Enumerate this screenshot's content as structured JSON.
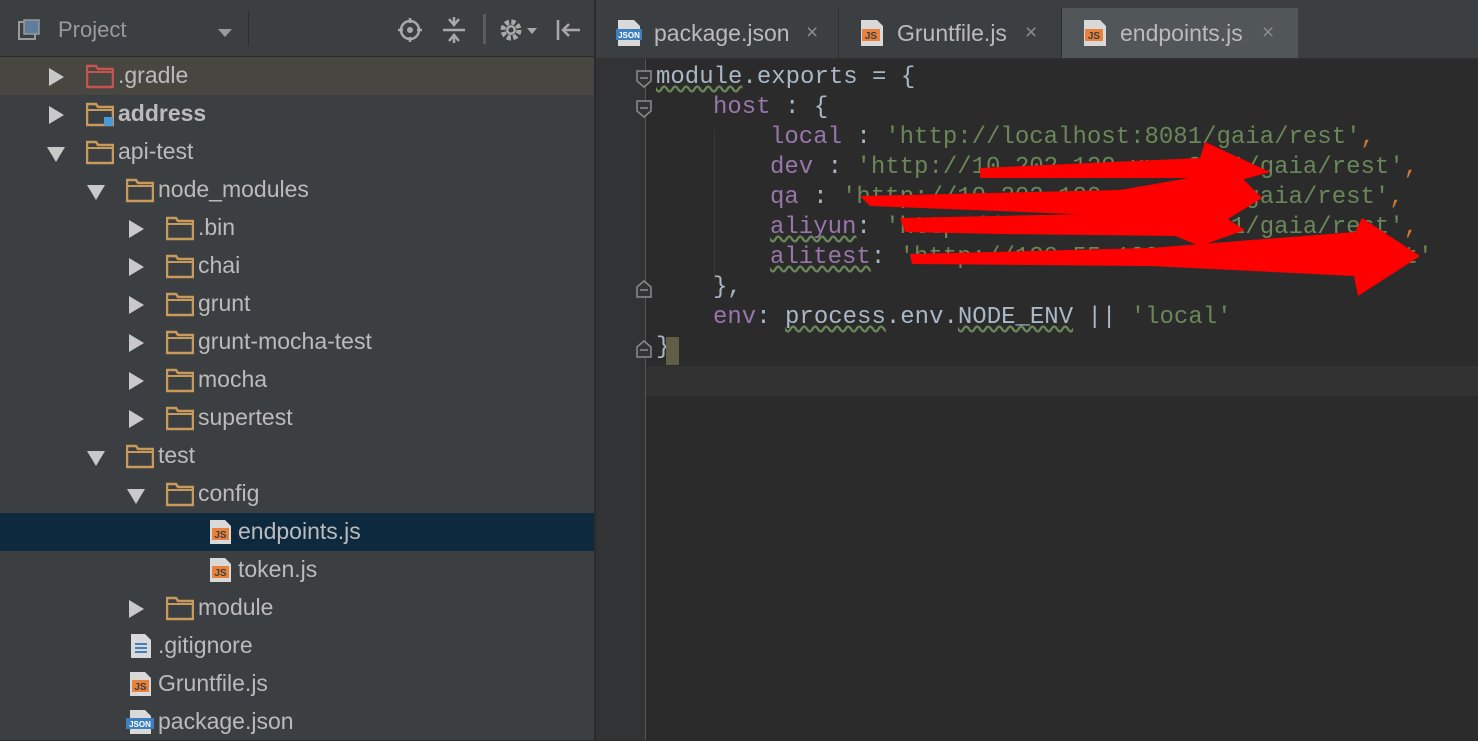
{
  "project_panel": {
    "title": "Project",
    "icons": [
      "project-view-icon",
      "dropdown-caret-icon",
      "locate-icon",
      "collapse-all-icon",
      "gear-icon",
      "hide-panel-icon"
    ],
    "tree": [
      {
        "label": ".gradle",
        "type": "folder",
        "depth": 0,
        "expanded": false,
        "color": "#c75450",
        "highlighted": true
      },
      {
        "label": "address",
        "type": "module-folder",
        "depth": 0,
        "expanded": false,
        "bold": true
      },
      {
        "label": "api-test",
        "type": "folder",
        "depth": 0,
        "expanded": true
      },
      {
        "label": "node_modules",
        "type": "folder",
        "depth": 1,
        "expanded": true
      },
      {
        "label": ".bin",
        "type": "folder",
        "depth": 2,
        "expanded": false
      },
      {
        "label": "chai",
        "type": "folder",
        "depth": 2,
        "expanded": false
      },
      {
        "label": "grunt",
        "type": "folder",
        "depth": 2,
        "expanded": false
      },
      {
        "label": "grunt-mocha-test",
        "type": "folder",
        "depth": 2,
        "expanded": false
      },
      {
        "label": "mocha",
        "type": "folder",
        "depth": 2,
        "expanded": false
      },
      {
        "label": "supertest",
        "type": "folder",
        "depth": 2,
        "expanded": false
      },
      {
        "label": "test",
        "type": "folder",
        "depth": 1,
        "expanded": true
      },
      {
        "label": "config",
        "type": "folder",
        "depth": 2,
        "expanded": true
      },
      {
        "label": "endpoints.js",
        "type": "js",
        "depth": 3,
        "selected": true
      },
      {
        "label": "token.js",
        "type": "js",
        "depth": 3
      },
      {
        "label": "module",
        "type": "folder",
        "depth": 2,
        "expanded": false
      },
      {
        "label": ".gitignore",
        "type": "text",
        "depth": 1
      },
      {
        "label": "Gruntfile.js",
        "type": "js",
        "depth": 1
      },
      {
        "label": "package.json",
        "type": "json",
        "depth": 1
      }
    ]
  },
  "editor": {
    "tabs": [
      {
        "label": "package.json",
        "icon": "json-file-icon",
        "close": "×",
        "active": false
      },
      {
        "label": "Gruntfile.js",
        "icon": "js-file-icon",
        "close": "×",
        "active": false
      },
      {
        "label": "endpoints.js",
        "icon": "js-file-icon",
        "close": "×",
        "active": true
      }
    ],
    "code": {
      "line1": {
        "a": "module",
        "b": ".",
        "c": "exports",
        "d": " = {"
      },
      "line2": {
        "key": "host",
        "rest": " : {"
      },
      "line3": {
        "key": "local",
        "sep": " : ",
        "val": "'http://localhost:8081/gaia/rest'",
        "end": ","
      },
      "line4": {
        "key": "dev",
        "sep": " : ",
        "val": "'http://10.202.120.xxx:8081/gaia/rest'",
        "end": ","
      },
      "line5": {
        "key": "qa",
        "sep": " : ",
        "val": "'http://10.202.120.xxx:8081/gaia/rest'",
        "end": ","
      },
      "line6": {
        "key": "aliyun",
        "sep": ": ",
        "val": "'http://120.xx.xx.xx:8081/gaia/rest'",
        "end": ","
      },
      "line7": {
        "key": "alitest",
        "sep": ": ",
        "val": "'http://120.55.120.xx:8081/gaia/rest'",
        "end": ""
      },
      "line8": {
        "text": "},"
      },
      "line9": {
        "key": "env",
        "sep": ": ",
        "obj": "process",
        "dot1": ".",
        "env": "env",
        "dot2": ".",
        "var": "NODE_ENV",
        "or": " || ",
        "val": "'local'"
      },
      "line10": {
        "text": "}"
      }
    },
    "annotation_color": "#ff0000"
  },
  "colors": {
    "panel_bg": "#3c3f41",
    "editor_bg": "#2b2b2b",
    "selection": "#0d293e",
    "keyword": "#cc7832",
    "property": "#9876aa",
    "string": "#6a8759",
    "folder": "#c89b5c"
  }
}
